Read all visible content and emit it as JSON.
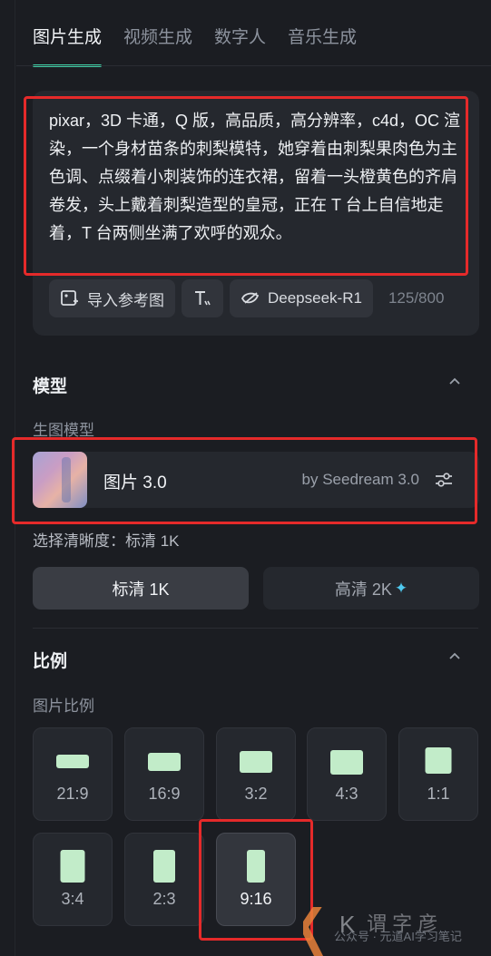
{
  "tabs": [
    "图片生成",
    "视频生成",
    "数字人",
    "音乐生成"
  ],
  "prompt": {
    "text": "pixar，3D 卡通，Q 版，高品质，高分辨率，c4d，OC 渲染，一个身材苗条的刺梨模特，她穿着由刺梨果肉色为主色调、点缀着小刺装饰的连衣裙，留着一头橙黄色的齐肩卷发，头上戴着刺梨造型的皇冠，正在 T 台上自信地走着，T 台两侧坐满了欢呼的观众。",
    "import_ref": "导入参考图",
    "deepseek": "Deepseek-R1",
    "counter": "125/800"
  },
  "model_section": {
    "title": "模型",
    "subtitle": "生图模型",
    "model_name": "图片 3.0",
    "model_by": "by Seedream 3.0",
    "resolution_label": "选择清晰度：标清 1K",
    "res_sd": "标清 1K",
    "res_hd": "高清 2K"
  },
  "ratio_section": {
    "title": "比例",
    "subtitle": "图片比例",
    "ratios": [
      "21:9",
      "16:9",
      "3:2",
      "4:3",
      "1:1",
      "3:4",
      "2:3",
      "9:16"
    ],
    "selected": "9:16"
  },
  "watermark": {
    "text": "公众号 · 元道AI学习笔记"
  },
  "colors": {
    "accent": "#3fd0a6",
    "highlight": "#e52a2a",
    "shape": "#c2ecc9",
    "sparkle": "#4fc9ef"
  }
}
